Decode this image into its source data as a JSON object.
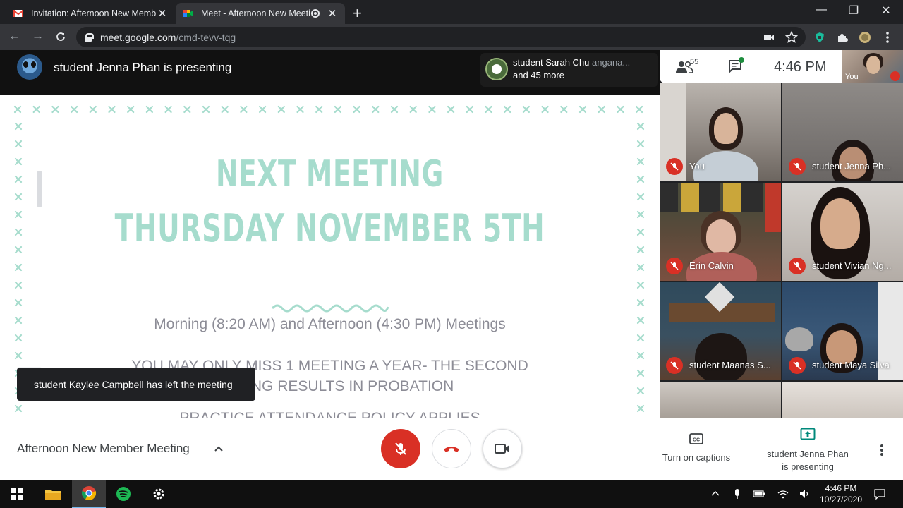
{
  "browser": {
    "tabs": [
      {
        "title": "Invitation: Afternoon New Memb",
        "close": "✕"
      },
      {
        "title": "Meet - Afternoon New Meeti",
        "close": "✕"
      }
    ],
    "new_tab": "+",
    "window_controls": {
      "minimize": "—",
      "restore": "❐",
      "close": "✕"
    },
    "url_host": "meet.google.com",
    "url_path": "/cmd-tevv-tqg"
  },
  "meet": {
    "presenting_banner": "student Jenna Phan is presenting",
    "joined": {
      "name": "student Sarah Chu",
      "name_overlap": "anganа...",
      "more": "and 45 more"
    },
    "people_count": "55",
    "clock": "4:46  PM",
    "self_tile_label": "You",
    "slide": {
      "title_line1": "NEXT MEETING",
      "title_line2": "THURSDAY NOVEMBER 5TH",
      "subtitle": "Morning (8:20 AM) and Afternoon (4:30 PM) Meetings",
      "warning_line1": "YOU MAY ONLY MISS 1 MEETING A YEAR- THE SECOND",
      "warning_line2": "MEETING RESULTS IN PROBATION",
      "cut_line": "PRACTICE ATTENDANCE POLICY APPLIES"
    },
    "toast": "student Kaylee Campbell has left the meeting",
    "participants": [
      {
        "name": "You"
      },
      {
        "name": "student Jenna Ph..."
      },
      {
        "name": "Erin Calvin"
      },
      {
        "name": "student Vivian Ng..."
      },
      {
        "name": "student Maanas S..."
      },
      {
        "name": "student Maya Silva"
      }
    ],
    "meeting_name": "Afternoon New Member Meeting",
    "captions_label": "Turn on captions",
    "present_label_line1": "student Jenna Phan",
    "present_label_line2": "is presenting"
  },
  "taskbar": {
    "time": "4:46 PM",
    "date": "10/27/2020"
  },
  "colors": {
    "slide_accent": "#a6dccd",
    "mute_red": "#d93025",
    "meet_green": "#1e8e3e",
    "present_teal": "#00897b"
  }
}
